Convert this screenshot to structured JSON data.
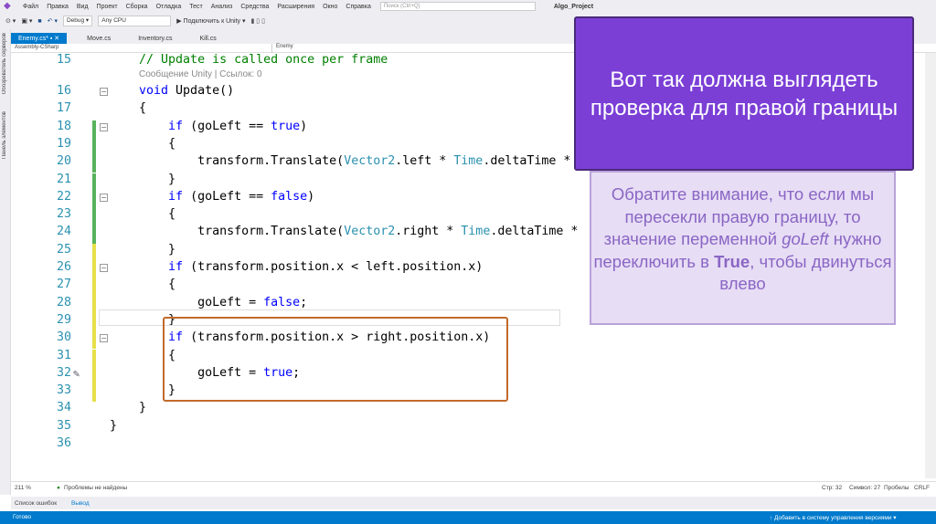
{
  "menu": {
    "items": [
      "Файл",
      "Правка",
      "Вид",
      "Проект",
      "Сборка",
      "Отладка",
      "Тест",
      "Анализ",
      "Средства",
      "Расширения",
      "Окно",
      "Справка"
    ],
    "search_placeholder": "Поиск (Ctrl+Q)",
    "project": "Algo_Project"
  },
  "toolbar": {
    "config": "Debug",
    "platform": "Any CPU",
    "attach": "▶ Подключить к Unity ▾"
  },
  "sidebar": {
    "items": [
      "Обозреватель серверов",
      "Панель элементов"
    ]
  },
  "tabs": [
    {
      "label": "Enemy.cs*  ▪ ✕"
    },
    {
      "label": "Move.cs"
    },
    {
      "label": "Inventory.cs"
    },
    {
      "label": "Kill.cs"
    }
  ],
  "nav": {
    "project": "Assembly-CSharp",
    "class": "Enemy"
  },
  "code": {
    "lens": "Сообщение Unity | Ссылок: 0",
    "lines": [
      {
        "n": "15",
        "parts": [
          [
            "cm",
            "    // Update is called once per frame"
          ]
        ]
      },
      {
        "n": "16",
        "parts": [
          [
            "kw",
            "    void"
          ],
          [
            "",
            "Update()"
          ]
        ]
      },
      {
        "n": "17",
        "parts": [
          [
            "",
            "    {"
          ]
        ]
      },
      {
        "n": "18",
        "parts": [
          [
            "",
            "        "
          ],
          [
            "kw",
            "if"
          ],
          [
            "",
            " (goLeft == "
          ],
          [
            "kw",
            "true"
          ],
          [
            "",
            ")"
          ]
        ]
      },
      {
        "n": "19",
        "parts": [
          [
            "",
            "        {"
          ]
        ]
      },
      {
        "n": "20",
        "parts": [
          [
            "",
            "            transform.Translate("
          ],
          [
            "ty",
            "Vector2"
          ],
          [
            "",
            ".left * "
          ],
          [
            "ty",
            "Time"
          ],
          [
            "",
            ".deltaTime *"
          ]
        ]
      },
      {
        "n": "21",
        "parts": [
          [
            "",
            "        }"
          ]
        ]
      },
      {
        "n": "22",
        "parts": [
          [
            "",
            "        "
          ],
          [
            "kw",
            "if"
          ],
          [
            "",
            " (goLeft == "
          ],
          [
            "kw",
            "false"
          ],
          [
            "",
            ")"
          ]
        ]
      },
      {
        "n": "23",
        "parts": [
          [
            "",
            "        {"
          ]
        ]
      },
      {
        "n": "24",
        "parts": [
          [
            "",
            "            transform.Translate("
          ],
          [
            "ty",
            "Vector2"
          ],
          [
            "",
            ".right * "
          ],
          [
            "ty",
            "Time"
          ],
          [
            "",
            ".deltaTime *"
          ]
        ]
      },
      {
        "n": "25",
        "parts": [
          [
            "",
            "        }"
          ]
        ]
      },
      {
        "n": "26",
        "parts": [
          [
            "",
            "        "
          ],
          [
            "kw",
            "if"
          ],
          [
            "",
            " (transform.position.x < left.position.x)"
          ]
        ]
      },
      {
        "n": "27",
        "parts": [
          [
            "",
            "        {"
          ]
        ]
      },
      {
        "n": "28",
        "parts": [
          [
            "",
            "            goLeft = "
          ],
          [
            "kw",
            "false"
          ],
          [
            "",
            ";"
          ]
        ]
      },
      {
        "n": "29",
        "parts": [
          [
            "",
            "        }"
          ]
        ]
      },
      {
        "n": "30",
        "parts": [
          [
            "",
            "        "
          ],
          [
            "kw",
            "if"
          ],
          [
            "",
            " (transform.position.x > right.position.x)"
          ]
        ]
      },
      {
        "n": "31",
        "parts": [
          [
            "",
            "        {"
          ]
        ]
      },
      {
        "n": "32",
        "parts": [
          [
            "",
            "            goLeft = "
          ],
          [
            "kw",
            "true"
          ],
          [
            "",
            ";"
          ]
        ]
      },
      {
        "n": "33",
        "parts": [
          [
            "",
            "        }"
          ]
        ]
      },
      {
        "n": "34",
        "parts": [
          [
            "",
            "    }"
          ]
        ]
      },
      {
        "n": "35",
        "parts": [
          [
            "",
            "}"
          ]
        ]
      },
      {
        "n": "36",
        "parts": []
      }
    ]
  },
  "status": {
    "zoom": "211 %",
    "problems": "Проблемы не найдены",
    "line": "Стр: 32",
    "col": "Символ: 27",
    "spaces": "Пробелы",
    "eol": "CRLF"
  },
  "bottom_tabs": [
    "Список ошибок",
    "Вывод"
  ],
  "statusbar": {
    "ready": "Готово",
    "vcs": "↑ Добавить в систему управления версиями ▾"
  },
  "callout": {
    "title": "Вот так должна выглядеть проверка для правой границы",
    "note_before": "Обратите внимание, что если мы пересекли правую границу, то значение переменной ",
    "note_var": "goLeft",
    "note_mid": " нужно переключить в ",
    "note_bold": "True",
    "note_after": ", чтобы двинуться влево"
  }
}
